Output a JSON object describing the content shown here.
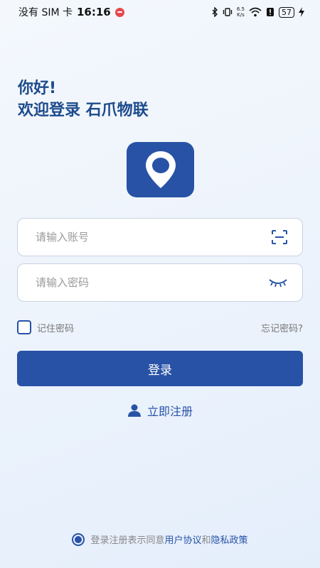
{
  "status_bar": {
    "carrier": "没有 SIM 卡",
    "time": "16:16",
    "net_speed_top": "6.5",
    "net_speed_bottom": "K/s",
    "battery": "57",
    "icons": [
      "bluetooth-icon",
      "vibrate-icon",
      "wifi-icon",
      "alert-icon",
      "battery-icon",
      "charging-icon"
    ]
  },
  "greeting": {
    "line1": "你好!",
    "line2": "欢迎登录 石爪物联"
  },
  "logo": {
    "icon": "location-pin-icon",
    "color": "#2852a6"
  },
  "account_field": {
    "placeholder": "请输入账号",
    "value": "",
    "icon": "scan-icon"
  },
  "password_field": {
    "placeholder": "请输入密码",
    "value": "",
    "icon": "eye-closed-icon"
  },
  "remember_label": "记住密码",
  "forgot_label": "忘记密码?",
  "login_label": "登录",
  "register_label": "立即注册",
  "agreement": {
    "prefix": "登录注册表示同意",
    "user_agreement": "用户协议",
    "and": "和",
    "privacy_policy": "隐私政策"
  },
  "colors": {
    "primary": "#2852a6",
    "heading": "#1d4b8c"
  }
}
